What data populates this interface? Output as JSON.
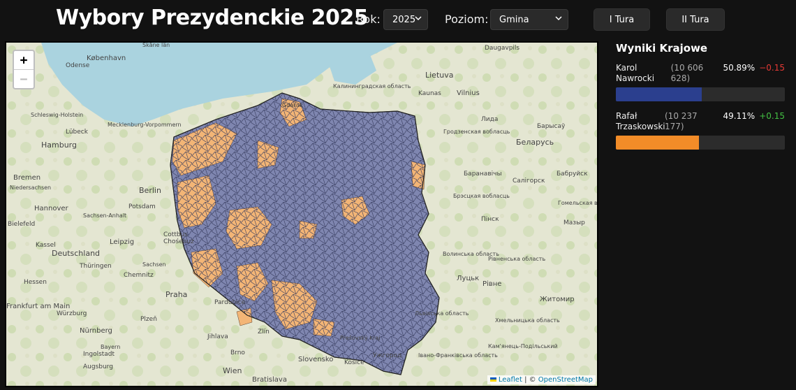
{
  "header": {
    "title": "Wybory Prezydenckie 2025",
    "year_label": "Rok:",
    "year_value": "2025",
    "level_label": "Poziom:",
    "level_value": "Gmina",
    "round1_label": "I Tura",
    "round2_label": "II Tura"
  },
  "map": {
    "zoom_in": "+",
    "zoom_out": "−",
    "attribution": {
      "leaflet": "Leaflet",
      "separator": " | © ",
      "osm": "OpenStreetMap"
    },
    "labels": [
      "København",
      "Odense",
      "Lietuva",
      "Kaunas",
      "Vilnius",
      "Daugavpils",
      "Hamburg",
      "Lübeck",
      "Bremen",
      "Berlin",
      "Potsdam",
      "Hannover",
      "Bielefeld",
      "Kassel",
      "Leipzig",
      "Cottbus",
      "Chośebuz",
      "Deutschland",
      "Thüringen",
      "Chemnitz",
      "Praha",
      "Hessen",
      "Würzburg",
      "Nürnberg",
      "Plzeň",
      "Jihlava",
      "Zlín",
      "Slovensko",
      "Bratislava",
      "Wien",
      "Ingolstadt",
      "Augsburg",
      "Беларусь",
      "Гомельская вобласць",
      "Барысаў",
      "Баранавічы",
      "Салігорск",
      "Бабруйск",
      "Брэсцкая вобласць",
      "Пінск",
      "Мазыр",
      "Луцьк",
      "Рівне",
      "Житомир",
      "Волинська область",
      "Рівненська область",
      "Львівська область",
      "Хмельницька область",
      "Ужгород",
      "Кам'янець-Подільський",
      "Івано-Франківська область",
      "Pardubice",
      "Brno",
      "Prešovský kraj",
      "Košice",
      "Mecklenburg-Vorpommern",
      "Schleswig-Holstein",
      "Niedersachsen",
      "Sachsen-Anhalt",
      "Sachsen",
      "Bayern",
      "Frankfurt am Main",
      "Gdańsk",
      "Калининградская область",
      "Гродзенская вобласць",
      "Лида",
      "Skåne län"
    ]
  },
  "results": {
    "title": "Wyniki Krajowe",
    "candidates": [
      {
        "name": "Karol Nawrocki",
        "votes": "(10 606 628)",
        "pct": "50.89%",
        "delta": "−0.15",
        "share": 0.5089,
        "color": "#2b3f8e"
      },
      {
        "name": "Rafał Trzaskowski",
        "votes": "(10 237 177)",
        "pct": "49.11%",
        "delta": "+0.15",
        "share": 0.4911,
        "color": "#f28c28"
      }
    ]
  },
  "colors": {
    "nawrocki_map": "#7f86b0",
    "trzaskowski_map": "#f3b576",
    "water": "#aad3df"
  }
}
